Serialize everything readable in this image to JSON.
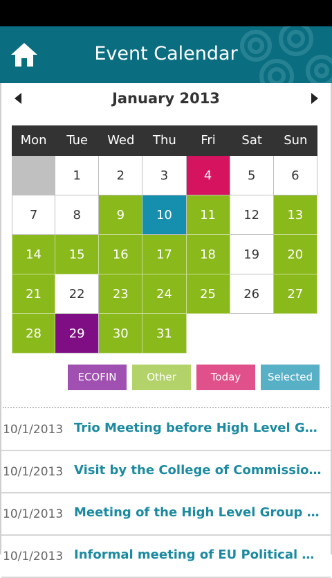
{
  "header": {
    "title": "Event Calendar",
    "home_icon": "home-icon"
  },
  "calendar": {
    "month_label": "January 2013",
    "weekdays": [
      "Mon",
      "Tue",
      "Wed",
      "Thu",
      "Fri",
      "Sat",
      "Sun"
    ],
    "days": [
      {
        "n": "",
        "s": "blank"
      },
      {
        "n": "1",
        "s": "plain"
      },
      {
        "n": "2",
        "s": "plain"
      },
      {
        "n": "3",
        "s": "plain"
      },
      {
        "n": "4",
        "s": "today"
      },
      {
        "n": "5",
        "s": "plain"
      },
      {
        "n": "6",
        "s": "plain"
      },
      {
        "n": "7",
        "s": "plain"
      },
      {
        "n": "8",
        "s": "plain"
      },
      {
        "n": "9",
        "s": "other"
      },
      {
        "n": "10",
        "s": "selected"
      },
      {
        "n": "11",
        "s": "other"
      },
      {
        "n": "12",
        "s": "plain"
      },
      {
        "n": "13",
        "s": "other"
      },
      {
        "n": "14",
        "s": "other"
      },
      {
        "n": "15",
        "s": "other"
      },
      {
        "n": "16",
        "s": "other"
      },
      {
        "n": "17",
        "s": "other"
      },
      {
        "n": "18",
        "s": "other"
      },
      {
        "n": "19",
        "s": "plain"
      },
      {
        "n": "20",
        "s": "other"
      },
      {
        "n": "21",
        "s": "other"
      },
      {
        "n": "22",
        "s": "plain"
      },
      {
        "n": "23",
        "s": "other"
      },
      {
        "n": "24",
        "s": "other"
      },
      {
        "n": "25",
        "s": "other"
      },
      {
        "n": "26",
        "s": "plain"
      },
      {
        "n": "27",
        "s": "other"
      },
      {
        "n": "28",
        "s": "other"
      },
      {
        "n": "29",
        "s": "ecofin"
      },
      {
        "n": "30",
        "s": "other"
      },
      {
        "n": "31",
        "s": "other"
      }
    ]
  },
  "legend": {
    "ecofin": "ECOFIN",
    "other": "Other",
    "today": "Today",
    "selected": "Selected"
  },
  "colors": {
    "header": "#0a6e80",
    "other": "#8ab91b",
    "today": "#d6135e",
    "selected": "#168fae",
    "ecofin": "#7f0d84",
    "link": "#1b8aa0"
  },
  "events": [
    {
      "date": "10/1/2013",
      "title": "Trio Meeting before High Level Gro..."
    },
    {
      "date": "10/1/2013",
      "title": "Visit by the College of Commissioners"
    },
    {
      "date": "10/1/2013",
      "title": "Meeting of the High Level Group on..."
    },
    {
      "date": "10/1/2013",
      "title": "Informal meeting of EU Political Dir..."
    }
  ]
}
